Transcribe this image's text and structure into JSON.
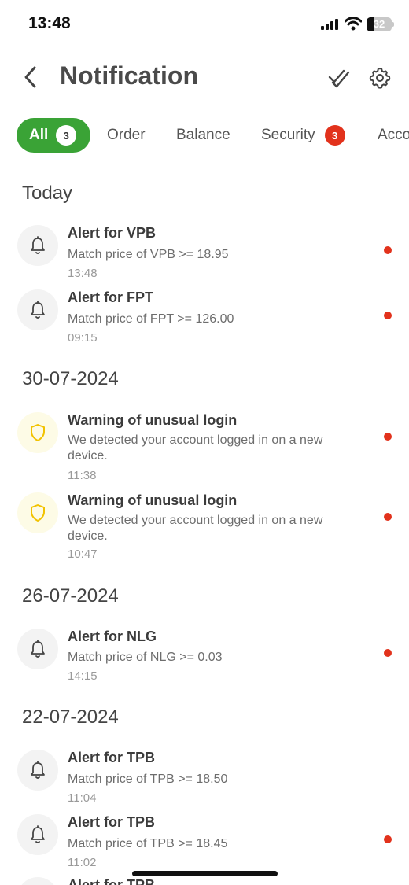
{
  "status_bar": {
    "time": "13:48",
    "battery": "32",
    "battery_level": 0.32,
    "icons": [
      "signal-icon",
      "wifi-icon",
      "battery-icon"
    ]
  },
  "header": {
    "title": "Notification",
    "icons": [
      "back-chevron-icon",
      "double-check-icon",
      "gear-icon"
    ]
  },
  "tabs": [
    {
      "label": "All",
      "badge": "3",
      "active": true
    },
    {
      "label": "Order"
    },
    {
      "label": "Balance"
    },
    {
      "label": "Security",
      "badge": "3"
    },
    {
      "label": "Acco"
    }
  ],
  "sections": [
    {
      "date": "Today",
      "items": [
        {
          "icon": "bell-icon",
          "title": "Alert for VPB",
          "body": "Match price of VPB >= 18.95",
          "time": "13:48",
          "unread": true
        },
        {
          "icon": "bell-icon",
          "title": "Alert for FPT",
          "body": "Match price of FPT >= 126.00",
          "time": "09:15",
          "unread": true
        }
      ]
    },
    {
      "date": "30-07-2024",
      "items": [
        {
          "icon": "shield-icon",
          "title": "Warning of unusual login",
          "body": "We detected your account logged in on a new device.",
          "time": "11:38",
          "unread": true
        },
        {
          "icon": "shield-icon",
          "title": "Warning of unusual login",
          "body": "We detected your account logged in on a new device.",
          "time": "10:47",
          "unread": true
        }
      ]
    },
    {
      "date": "26-07-2024",
      "items": [
        {
          "icon": "bell-icon",
          "title": "Alert for NLG",
          "body": "Match price of NLG >= 0.03",
          "time": "14:15",
          "unread": true
        }
      ]
    },
    {
      "date": "22-07-2024",
      "items": [
        {
          "icon": "bell-icon",
          "title": "Alert for TPB",
          "body": "Match price of TPB >= 18.50",
          "time": "11:04",
          "unread": false
        },
        {
          "icon": "bell-icon",
          "title": "Alert for TPB",
          "body": "Match price of TPB >= 18.45",
          "time": "11:02",
          "unread": true
        },
        {
          "icon": "bell-icon",
          "title": "Alert for TPB"
        }
      ]
    }
  ],
  "colors": {
    "accent_green": "#3aa336",
    "badge_red": "#e2321c",
    "shield_yellow": "#f2c200"
  }
}
